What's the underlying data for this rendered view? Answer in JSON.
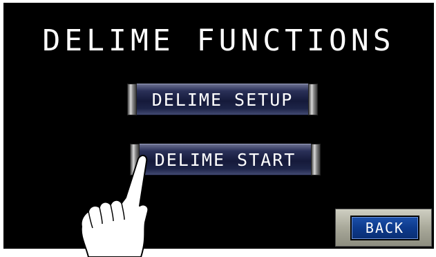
{
  "title": "DELIME FUNCTIONS",
  "buttons": {
    "setup_label": "DELIME SETUP",
    "start_label": "DELIME START",
    "back_label": "BACK"
  },
  "icons": {
    "pointer": "pointing-hand-icon"
  },
  "colors": {
    "screen_background": "#000000",
    "button_face": "#151a3a",
    "back_button_face": "#0d3a8c",
    "text": "#ffffff"
  }
}
